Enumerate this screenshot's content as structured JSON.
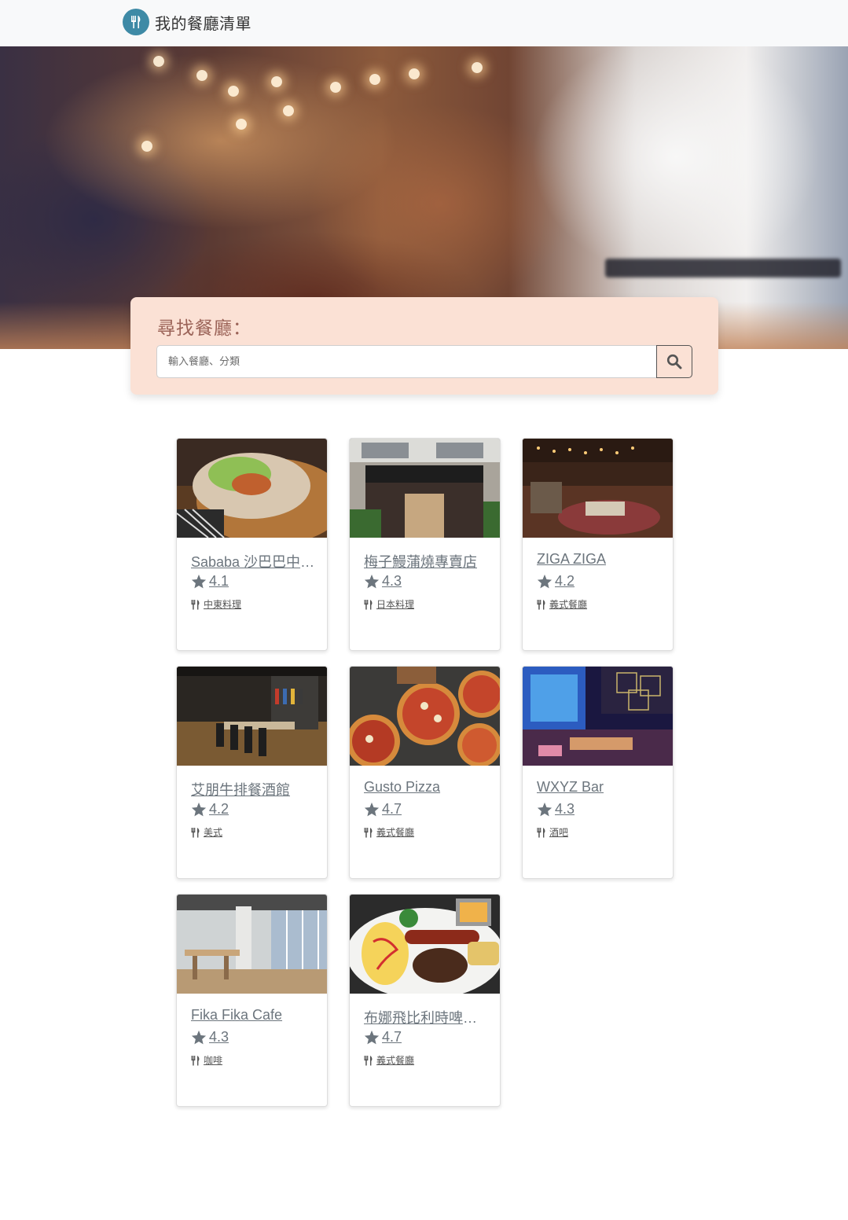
{
  "navbar": {
    "brand_title": "我的餐廳清單",
    "logo_icon": "utensils-icon",
    "logo_color": "#3e8aa6"
  },
  "search": {
    "title": "尋找餐廳：",
    "placeholder": "輸入餐廳、分類",
    "button_icon": "search-icon"
  },
  "restaurants": [
    {
      "name": "Sababa 沙巴巴中東戶外餐廳",
      "rating": "4.1",
      "category": "中東料理"
    },
    {
      "name": "梅子鰻蒲燒專賣店",
      "rating": "4.3",
      "category": "日本料理"
    },
    {
      "name": "ZIGA ZIGA",
      "rating": "4.2",
      "category": "義式餐廳"
    },
    {
      "name": "艾朋牛排餐酒館",
      "rating": "4.2",
      "category": "美式"
    },
    {
      "name": "Gusto Pizza",
      "rating": "4.7",
      "category": "義式餐廳"
    },
    {
      "name": "WXYZ Bar",
      "rating": "4.3",
      "category": "酒吧"
    },
    {
      "name": "Fika Fika Cafe",
      "rating": "4.3",
      "category": "咖啡"
    },
    {
      "name": "布娜飛比利時啤酒餐廳",
      "rating": "4.7",
      "category": "義式餐廳"
    }
  ],
  "colors": {
    "search_card_bg": "#fbe1d5",
    "search_title": "#9b6358",
    "card_text": "#6c757d"
  }
}
